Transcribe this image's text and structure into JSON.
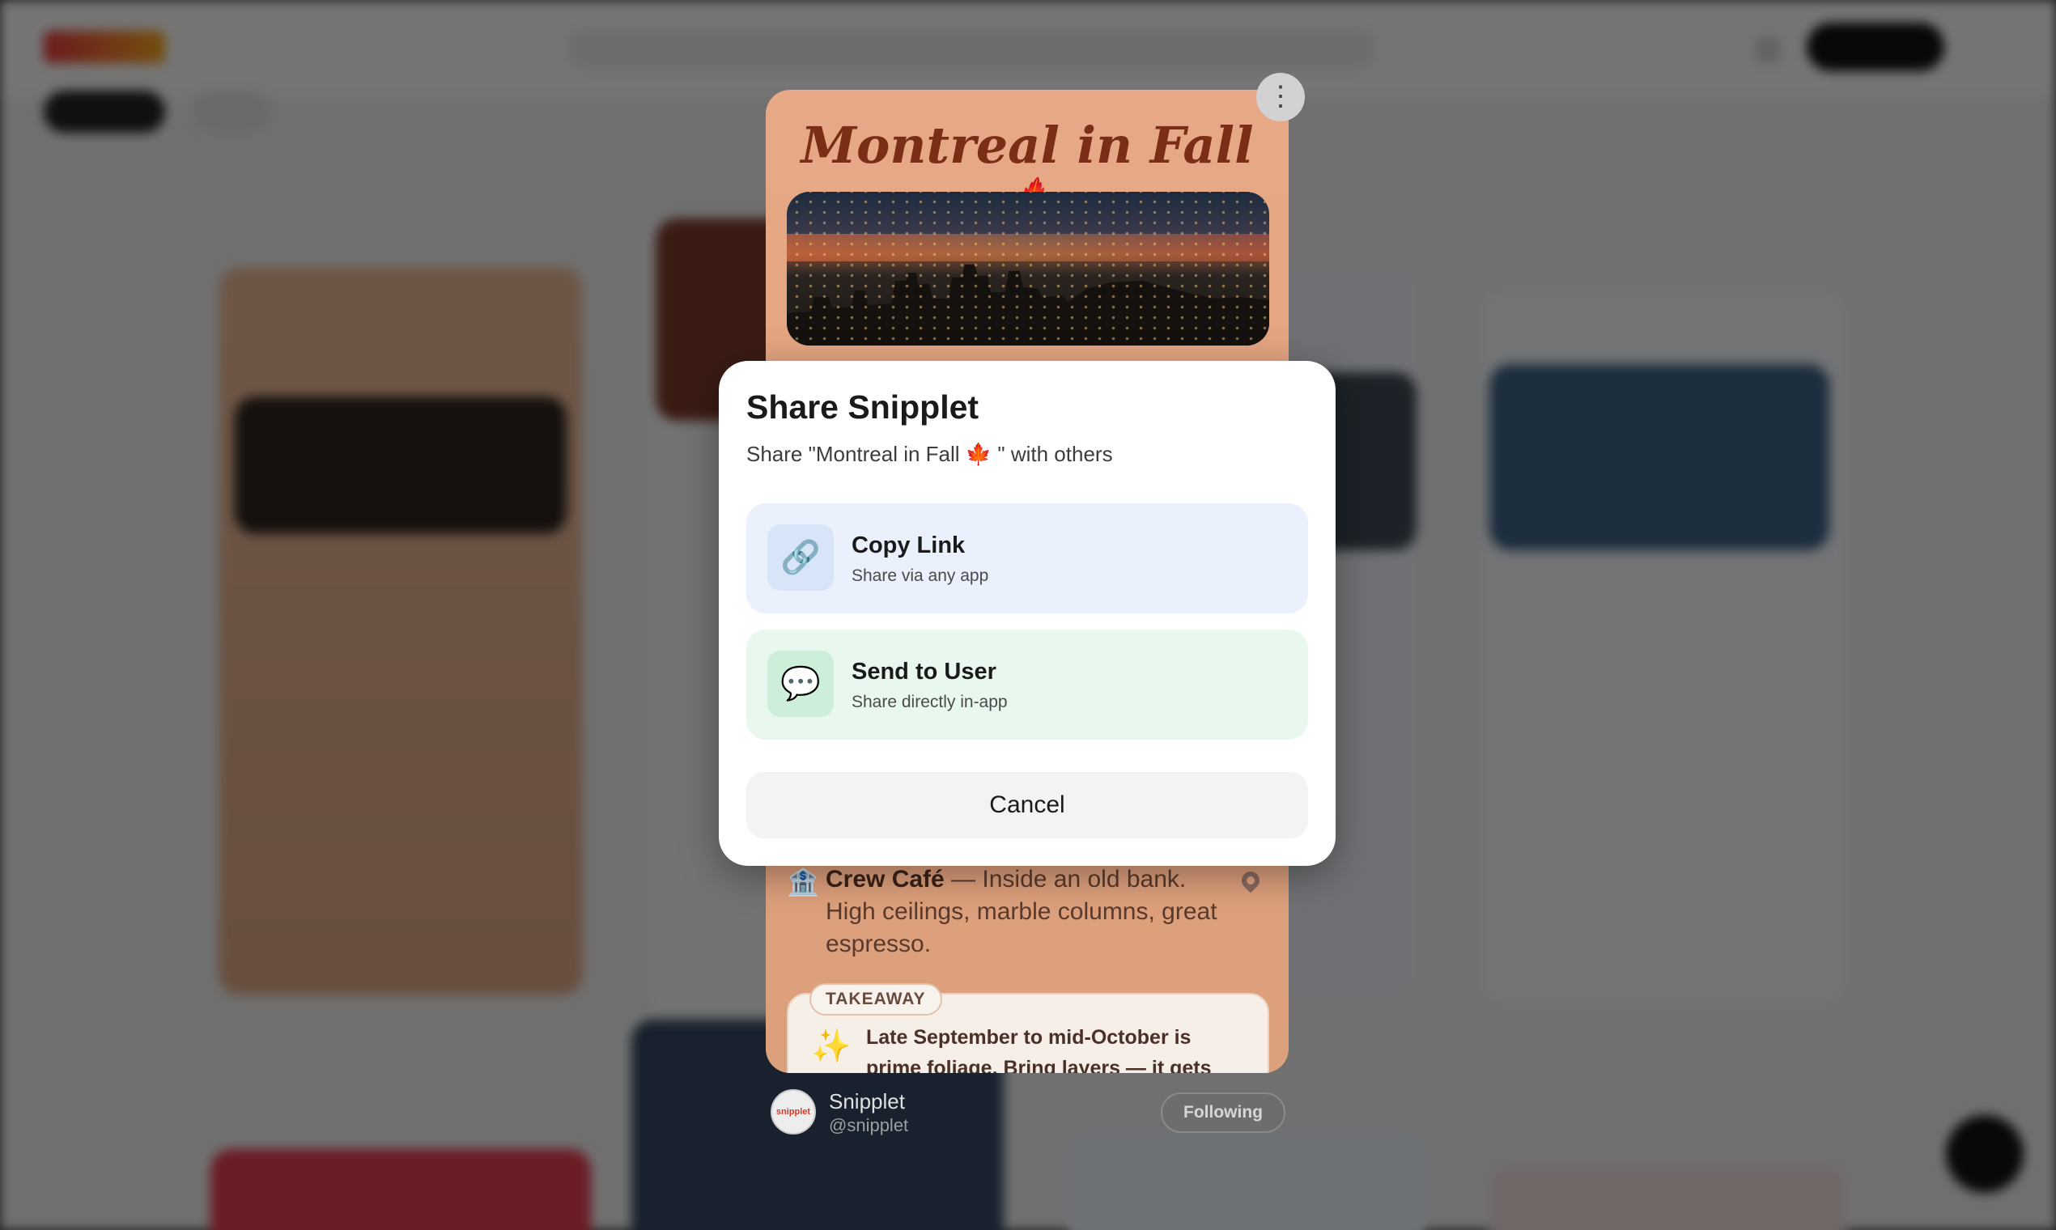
{
  "card": {
    "title": "Montreal in Fall",
    "title_emoji": "🍁",
    "crew": {
      "icon": "🏦",
      "name": "Crew Café",
      "desc": " — Inside an old bank. High ceilings, marble columns, great espresso."
    },
    "takeaway": {
      "tag": "TAKEAWAY",
      "icon": "✨",
      "text": "Late September to mid-October is prime foliage. Bring layers — it gets cold fast"
    }
  },
  "author": {
    "avatar_text": "snipplet",
    "name": "Snipplet",
    "handle": "@snipplet",
    "follow_label": "Following"
  },
  "modal": {
    "title": "Share Snipplet",
    "subtitle": "Share \"Montreal in Fall 🍁 \" with others",
    "options": [
      {
        "icon": "🔗",
        "icon_name": "link-icon",
        "label": "Copy Link",
        "desc": "Share via any app"
      },
      {
        "icon": "💬",
        "icon_name": "speech-bubble-icon",
        "label": "Send to User",
        "desc": "Share directly in-app"
      }
    ],
    "cancel_label": "Cancel"
  },
  "more_icon": "⋮",
  "colors": {
    "title": "#7a2e16",
    "copy_bg": "#eaf1fc",
    "send_bg": "#e8f8ee",
    "cancel_bg": "#f2f3f5"
  }
}
